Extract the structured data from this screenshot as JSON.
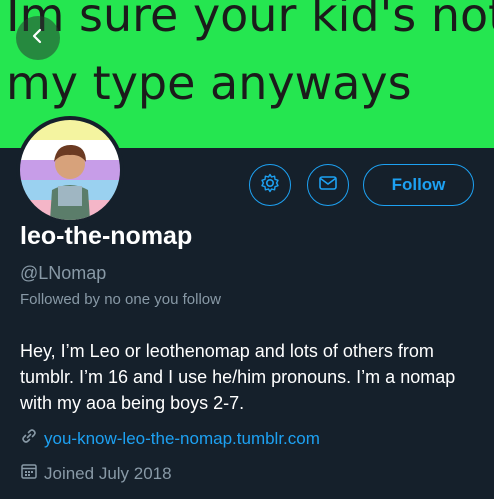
{
  "banner": {
    "line1": "Im sure your kid's not",
    "line2": "my type anyways",
    "background": "#25e650"
  },
  "actions": {
    "follow_label": "Follow"
  },
  "profile": {
    "display_name": "leo-the-nomap",
    "handle": "@LNomap",
    "followed_by": "Followed by no one you follow",
    "bio": "Hey, I’m Leo or leothenomap and lots of others from tumblr. I’m 16 and I use he/him pronouns. I’m a nomap with my aoa being boys 2-7.",
    "website": "you-know-leo-the-nomap.tumblr.com",
    "joined": "Joined July 2018"
  },
  "icons": {
    "back": "back-arrow-icon",
    "settings": "gear-icon",
    "message": "envelope-icon",
    "link": "link-icon",
    "calendar": "calendar-icon"
  },
  "colors": {
    "background": "#15202b",
    "accent": "#1da1f2",
    "muted": "#8899a6"
  }
}
